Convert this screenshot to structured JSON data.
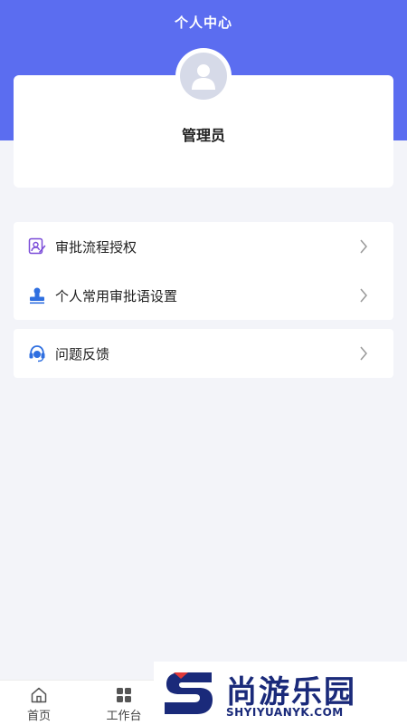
{
  "header": {
    "title": "个人中心"
  },
  "profile": {
    "name": "管理员"
  },
  "menu_group_1": [
    {
      "label": "审批流程授权",
      "icon": "approval-auth-icon"
    },
    {
      "label": "个人常用审批语设置",
      "icon": "stamp-icon"
    }
  ],
  "menu_group_2": [
    {
      "label": "问题反馈",
      "icon": "headset-icon"
    }
  ],
  "tabbar": {
    "tabs": [
      {
        "label": "首页",
        "icon": "home-icon"
      },
      {
        "label": "工作台",
        "icon": "workbench-icon"
      }
    ]
  },
  "watermark": {
    "cn": "尚游乐园",
    "en": "SHYIYUANYK.COM"
  },
  "colors": {
    "accent": "#5b6df0",
    "background": "#f3f4f9",
    "watermark": "#1a2a7a"
  }
}
